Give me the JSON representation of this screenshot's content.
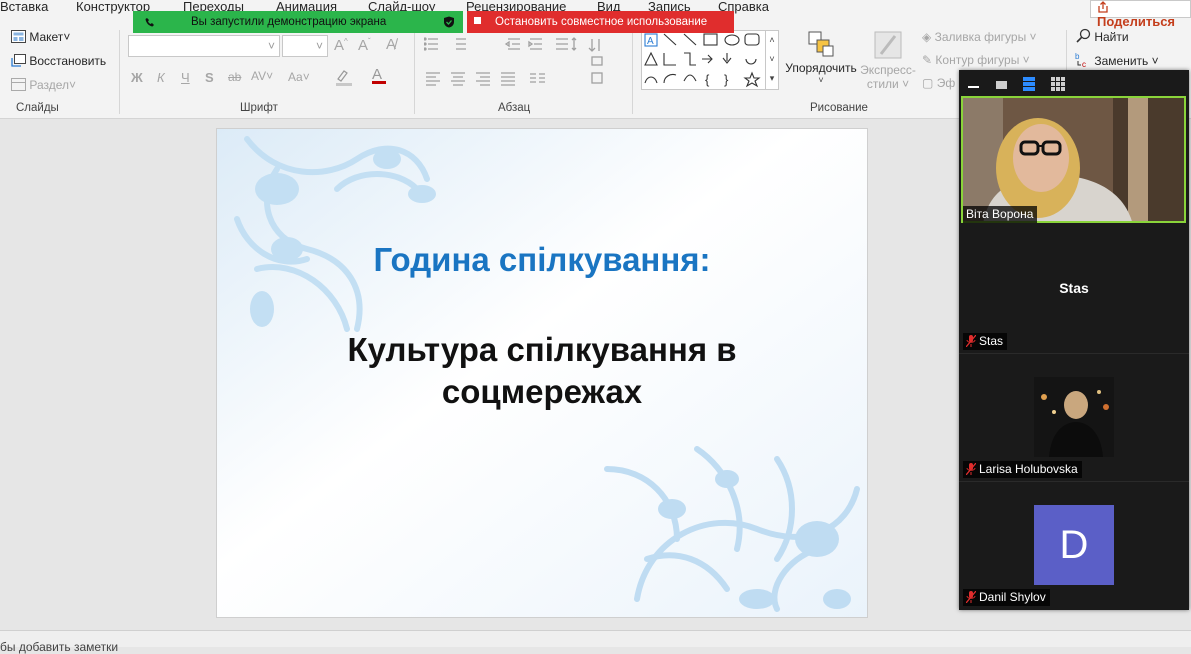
{
  "ribbon": {
    "tabs": [
      "Вставка",
      "Конструктор",
      "Переходы",
      "Анимация",
      "Слайд-шоу",
      "Рецензирование",
      "Вид",
      "Запись",
      "Справка"
    ],
    "share_label": "Поделиться",
    "slides_group": {
      "layout": "Макет",
      "reset": "Восстановить",
      "section": "Раздел",
      "label": "Слайды"
    },
    "font_group": {
      "label": "Шрифт",
      "bold": "Ж",
      "italic": "К",
      "underline": "Ч",
      "shadow": "S",
      "strike": "ab",
      "spacing": "AV",
      "case": "Aa"
    },
    "paragraph_group": {
      "label": "Абзац"
    },
    "drawing_group": {
      "label": "Рисование",
      "arrange": "Упорядочить",
      "quick_styles_1": "Экспресс-",
      "quick_styles_2": "стили",
      "shape_fill": "Заливка фигуры",
      "shape_outline": "Контур фигуры",
      "effects": "Эф"
    },
    "editing_group": {
      "find": "Найти",
      "replace": "Заменить"
    }
  },
  "share_banner": {
    "status": "Вы запустили демонстрацию экрана",
    "stop": "Остановить совместное использование"
  },
  "slide": {
    "title": "Година спілкування:",
    "subtitle_line1": "Культура спілкування в",
    "subtitle_line2": "соцмережах"
  },
  "notes_placeholder": "бы добавить заметки",
  "participants": [
    {
      "name": "Віта Ворона",
      "video": true
    },
    {
      "name": "Stas",
      "center_name": "Stas",
      "muted": true
    },
    {
      "name": "Larisa Holubovska",
      "muted": true
    },
    {
      "name": "Danil Shylov",
      "initial": "D",
      "muted": true
    }
  ],
  "colors": {
    "accent_blue": "#1a75c2",
    "banner_green": "#2bb54b",
    "banner_red": "#e02d2d",
    "share_orange": "#c43e1c",
    "avatar_purple": "#5b5fc7"
  }
}
